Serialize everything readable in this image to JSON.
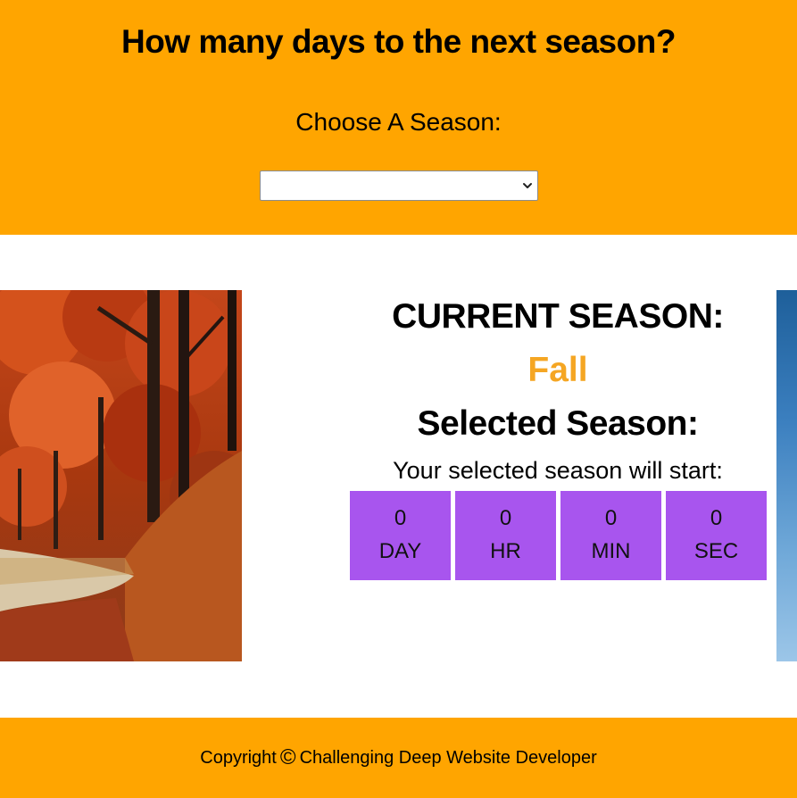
{
  "colors": {
    "accent": "#FFA500",
    "current_season": "#F5A623",
    "timer_cell": "#A855EE",
    "page_background": "#FFFFFF"
  },
  "header": {
    "title": "How many days to the next season?",
    "choose_label": "Choose A Season:",
    "season_select": {
      "selected_value": "",
      "icon": "chevron-down-icon"
    }
  },
  "main": {
    "image": {
      "subject": "autumn forest path with red and orange foliage"
    },
    "current_season_heading": "CURRENT SEASON:",
    "current_season_value": "Fall",
    "selected_season_heading": "Selected Season:",
    "start_text": "Your selected season will start:",
    "countdown": [
      {
        "value": "0",
        "unit": "DAY"
      },
      {
        "value": "0",
        "unit": "HR"
      },
      {
        "value": "0",
        "unit": "MIN"
      },
      {
        "value": "0",
        "unit": "SEC"
      }
    ]
  },
  "footer": {
    "prefix": "Copyright",
    "icon": "copyright-icon",
    "copyright_symbol": "©",
    "text": "Challenging Deep Website Developer"
  }
}
